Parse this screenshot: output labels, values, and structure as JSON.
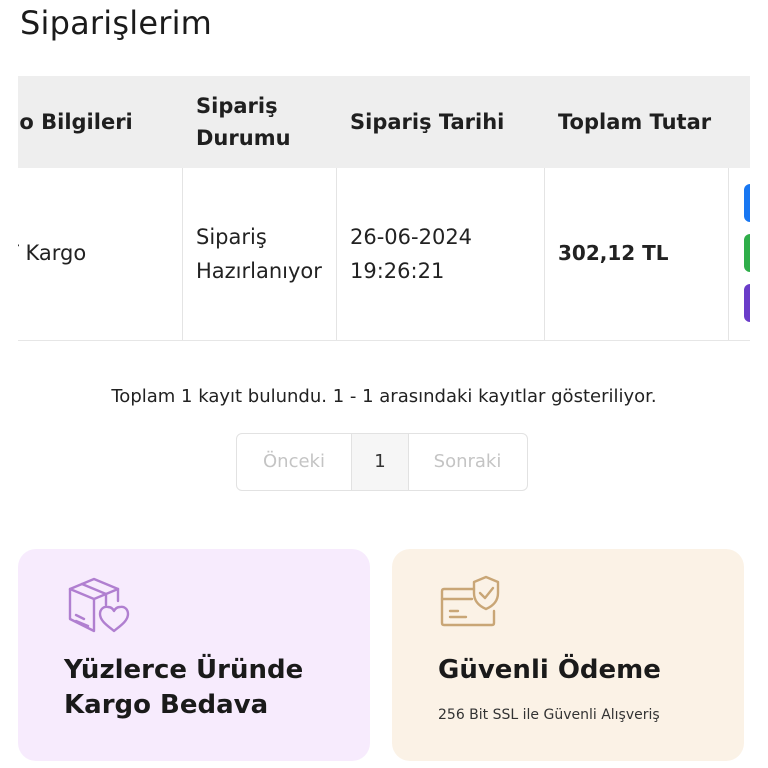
{
  "page": {
    "title": "Siparişlerim"
  },
  "orders_table": {
    "headers": {
      "cargo": "rgo Bilgileri",
      "status_line1": "Sipariş",
      "status_line2": "Durumu",
      "date": "Sipariş Tarihi",
      "total": "Toplam Tutar"
    },
    "rows": [
      {
        "cargo": "T Kargo",
        "status_line1": "Sipariş",
        "status_line2": "Hazırlanıyor",
        "date_line1": "26-06-2024",
        "date_line2": "19:26:21",
        "total": "302,12 TL"
      }
    ],
    "action_colors": [
      "#1877f2",
      "#2fae4a",
      "#6a3cc9"
    ]
  },
  "info_text": "Toplam 1 kayıt bulundu. 1 - 1 arasındaki kayıtlar gösteriliyor.",
  "pagination": {
    "prev_label": "Önceki",
    "current_page": "1",
    "next_label": "Sonraki"
  },
  "features": [
    {
      "icon": "heart-box-icon",
      "title_line1": "Yüzlerce Üründe",
      "title_line2": "Kargo Bedava",
      "color": "#b07fd0"
    },
    {
      "icon": "shield-card-icon",
      "title_line1": "Güvenli Ödeme",
      "subtitle": "256 Bit SSL ile Güvenli Alışveriş",
      "color": "#c9a676"
    }
  ]
}
